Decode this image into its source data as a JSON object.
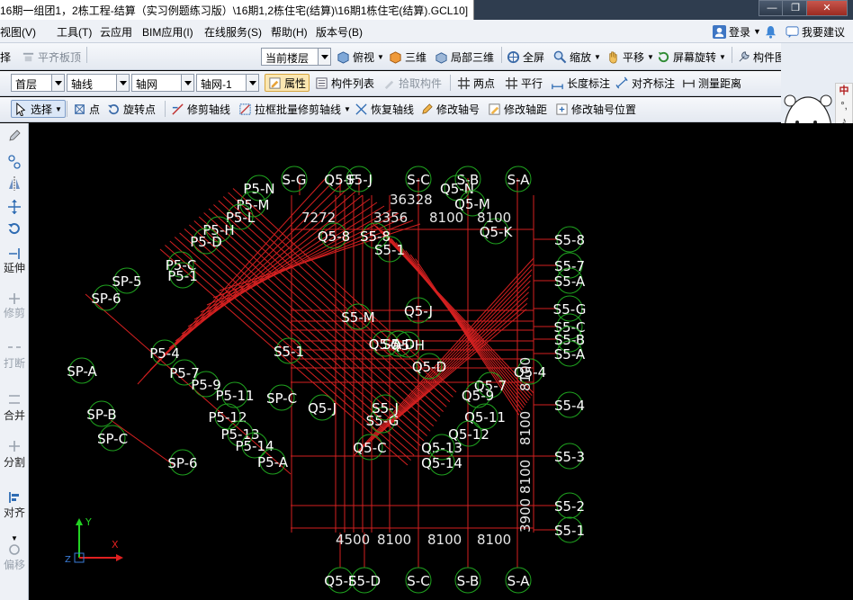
{
  "window": {
    "title": "16期一组团1，2栋工程-结算（实习例题练习版）\\16期1,2栋住宅(结算)\\16期1栋住宅(结算).GCL10]",
    "buttons": {
      "minimize": "—",
      "restore": "❐",
      "close": "✕"
    }
  },
  "menu": {
    "items": [
      "视图(V)",
      "工具(T)",
      "云应用",
      "BIM应用(I)",
      "在线服务(S)",
      "帮助(H)",
      "版本号(B)"
    ],
    "login": "登录",
    "suggest": "我要建议"
  },
  "toolbar1": {
    "left_items": [
      "择",
      "平齐板顶"
    ],
    "floor_combo": "当前楼层",
    "items": [
      "俯视",
      "三维",
      "局部三维",
      "全屏",
      "缩放",
      "平移",
      "屏幕旋转",
      "构件图元显示设置"
    ]
  },
  "toolbar2": {
    "combos": [
      "首层",
      "轴线",
      "轴网",
      "轴网-1"
    ],
    "items": [
      "属性",
      "构件列表",
      "拾取构件",
      "两点",
      "平行",
      "长度标注",
      "对齐标注",
      "测量距离"
    ]
  },
  "toolbar3": {
    "select": "选择",
    "items": [
      "点",
      "旋转点",
      "修剪轴线",
      "拉框批量修剪轴线",
      "恢复轴线",
      "修改轴号",
      "修改轴距",
      "修改轴号位置"
    ]
  },
  "left_toolbar": {
    "items": [
      "延伸",
      "修剪",
      "打断",
      "合并",
      "分割",
      "对齐",
      "偏移"
    ]
  },
  "side_panel": {
    "chars": [
      "中",
      "°,",
      "♪",
      "☎"
    ]
  },
  "colors": {
    "grid_line": "#d42020",
    "axis_circle": "#1fa31f",
    "axis_text": "#ffffff",
    "title_bar": "#2f3d4f"
  },
  "cad": {
    "top_axes": [
      "S-G",
      "Q5-F",
      "S5-J",
      "S-C",
      "S-B",
      "S-A"
    ],
    "bottom_axes": [
      "Q5-F",
      "S5-D",
      "S-C",
      "S-B",
      "S-A"
    ],
    "right_axes": [
      "S5-8",
      "S5-7",
      "S5-A",
      "S5-G",
      "S5-C",
      "S5-B",
      "S5-A",
      "S5-4",
      "S5-3",
      "S5-2",
      "S5-1"
    ],
    "left_axes": [
      "SP-5",
      "SP-6",
      "SP-A",
      "SP-B",
      "SP-C",
      "SP-6"
    ],
    "p5_axes": [
      "P5-N",
      "P5-M",
      "P5-L",
      "P5-H",
      "P5-D",
      "P5-C",
      "P5-1",
      "P5-4",
      "P5-7",
      "P5-9",
      "P5-11",
      "P5-12",
      "P5-13",
      "P5-14",
      "P5-A",
      "SP-C"
    ],
    "q5_axes": [
      "Q5-N",
      "Q5-M",
      "Q5-K",
      "Q5-J",
      "Q5-H",
      "Q5-D",
      "Q5-7",
      "Q5-9",
      "Q5-11",
      "Q5-12",
      "Q5-13",
      "Q5-14",
      "Q5-C",
      "Q5-J",
      "Q5-A",
      "Q5-4",
      "Q5-8"
    ],
    "s5_inner_axes": [
      "S5-8",
      "S5-1",
      "S5-G",
      "S5-1",
      "S5-D",
      "S5-J",
      "S5-M"
    ],
    "top_dims": [
      "36328",
      "7272",
      "3356",
      "8100",
      "8100"
    ],
    "bottom_dims": [
      "4500",
      "8100",
      "8100",
      "8100"
    ],
    "right_dims": [
      "8100",
      "8100",
      "8100",
      "3900"
    ]
  }
}
